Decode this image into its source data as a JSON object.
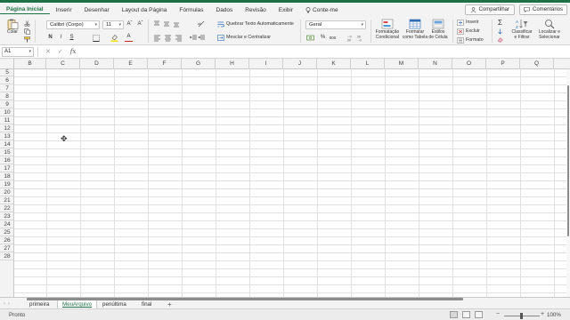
{
  "ribbon": {
    "tabs": [
      "Página Inicial",
      "Inserir",
      "Desenhar",
      "Layout da Página",
      "Fórmulas",
      "Dados",
      "Revisão",
      "Exibir"
    ],
    "tell_me": "Conte-me",
    "share": "Compartilhar",
    "comments": "Comentários",
    "paste_label": "Colar",
    "font_name": "Calibri (Corpo)",
    "font_size": "11",
    "wrap_text": "Quebrar Texto Automaticamente",
    "merge_center": "Mesclar e Centralizar",
    "number_format": "Geral",
    "conditional_formatting": [
      "Formatação",
      "Condicional"
    ],
    "format_as_table": [
      "Formatar",
      "como Tabela"
    ],
    "cell_styles": [
      "Estilos",
      "de Célula"
    ],
    "insert": "Inserir",
    "delete": "Excluir",
    "format": "Formato",
    "sort_filter": [
      "Classificar",
      "e Filtrar"
    ],
    "find_select": [
      "Localizar e",
      "Selecionar"
    ],
    "bold": "N",
    "italic": "I",
    "underline": "S",
    "font_color_glyph": "A",
    "percent": "%",
    "comma": "000",
    "increase_font": "Aˆ",
    "decrease_font": "Aˇ"
  },
  "formula_bar": {
    "name_box": "A1",
    "cancel": "✕",
    "enter": "✓",
    "fx": "fx",
    "value": ""
  },
  "grid": {
    "columns": [
      "B",
      "C",
      "D",
      "E",
      "F",
      "G",
      "H",
      "I",
      "J",
      "K",
      "L",
      "M",
      "N",
      "O",
      "P",
      "Q"
    ],
    "rows": [
      "5",
      "6",
      "7",
      "8",
      "9",
      "10",
      "11",
      "12",
      "13",
      "14",
      "15",
      "16",
      "17",
      "18",
      "19",
      "20",
      "21",
      "22",
      "23",
      "24",
      "25",
      "26",
      "27",
      "28"
    ]
  },
  "sheets": {
    "tabs": [
      "primeira",
      "MeuArquivo",
      "penúltima",
      "final"
    ],
    "active": "MeuArquivo",
    "add": "+"
  },
  "status": {
    "text": "Pronto",
    "zoom": "100%",
    "zoom_minus": "−",
    "zoom_plus": "+"
  },
  "colors": {
    "accent": "#1e7145",
    "ribbon_bg": "#f3f3f3",
    "gridline": "#e1e1e1"
  },
  "icons": [
    "paste-icon",
    "cut-icon",
    "copy-icon",
    "format-painter-icon",
    "borders-icon",
    "fill-color-icon",
    "font-color-icon",
    "align-icons",
    "wrap-icon",
    "merge-icon",
    "currency-icon",
    "percent-icon",
    "conditional-format-icon",
    "table-icon",
    "cell-styles-icon",
    "insert-icon",
    "delete-icon",
    "format-icon",
    "autosum-icon",
    "sort-filter-icon",
    "find-icon",
    "share-icon",
    "comment-icon",
    "lightbulb-icon",
    "cell-cursor-icon"
  ]
}
